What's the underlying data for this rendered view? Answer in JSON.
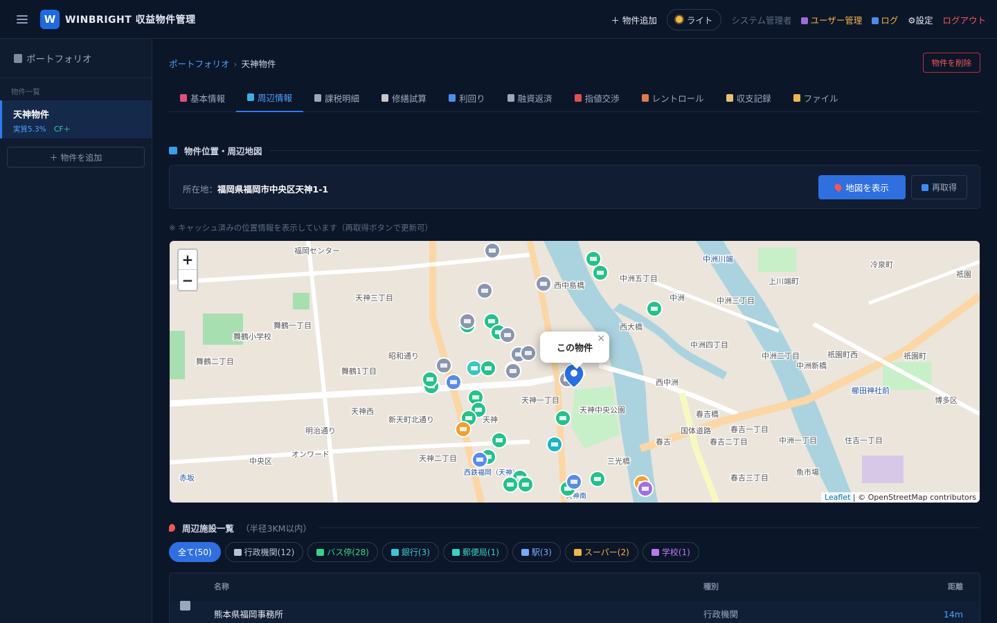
{
  "app": {
    "logo_letter": "W",
    "title": "WINBRIGHT 収益物件管理"
  },
  "topbar": {
    "add_property": "＋ 物件追加",
    "theme": "ライト",
    "role": "システム管理者",
    "user_mgmt": "ユーザー管理",
    "log": "ログ",
    "settings": "⚙設定",
    "logout": "ログアウト"
  },
  "sidebar": {
    "title": "ポートフォリオ",
    "section": "物件一覧",
    "property": {
      "name": "天神物件",
      "yield": "実質5.3%",
      "cf": "CF＋"
    },
    "add_button": "＋ 物件を追加"
  },
  "breadcrumb": {
    "root": "ポートフォリオ",
    "sep": "›",
    "current": "天神物件"
  },
  "delete_button": "物件を削除",
  "tabs": [
    {
      "label": "基本情報",
      "color": "#e0507a"
    },
    {
      "label": "周辺情報",
      "color": "#3ab0e0"
    },
    {
      "label": "課税明細",
      "color": "#9aa8bd"
    },
    {
      "label": "修繕試算",
      "color": "#c8c8c8"
    },
    {
      "label": "利回り",
      "color": "#4a8ee8"
    },
    {
      "label": "融資返済",
      "color": "#9aa8bd"
    },
    {
      "label": "指値交渉",
      "color": "#e05050"
    },
    {
      "label": "レントロール",
      "color": "#e07a50"
    },
    {
      "label": "収支記録",
      "color": "#e8c070"
    },
    {
      "label": "ファイル",
      "color": "#f0b44a"
    }
  ],
  "location": {
    "heading": "物件位置・周辺地図",
    "address_label": "所在地：",
    "address": "福岡県福岡市中央区天神1-1",
    "map_button": "地図を表示",
    "refetch_button": "再取得",
    "cache_note": "※ キャッシュ済みの位置情報を表示しています（再取得ボタンで更新可）"
  },
  "map": {
    "zoom_in": "+",
    "zoom_out": "−",
    "popup": "この物件",
    "popup_close": "×",
    "attribution_leaflet": "Leaflet",
    "attribution_rest": " | © OpenStreetMap contributors",
    "labels": [
      "天神二丁目",
      "天神三丁目",
      "舞鶴一丁目",
      "舞鶴二丁目",
      "舞鶴1丁目",
      "西中島橋",
      "中洲五丁目",
      "中洲",
      "中洲三丁目",
      "上川端町",
      "冷泉町",
      "祇園",
      "中洲川端",
      "西大橋",
      "中洲四丁目",
      "西中洲",
      "中洲二丁目",
      "中洲新橋",
      "祇園町西",
      "祇園町",
      "櫛田神社前",
      "博多区",
      "天神一丁目",
      "天神",
      "天神西",
      "中央区",
      "赤坂",
      "春吉",
      "春吉橋",
      "春吉一丁目",
      "春吉二丁目",
      "春吉三丁目",
      "中洲一丁目",
      "住吉一丁目",
      "西鉄福岡（天神）",
      "天神南",
      "オンワード",
      "新天町北通り",
      "明治通り",
      "昭和通り",
      "国体道路",
      "天神中央公園",
      "舞鶴小学校",
      "福岡センター",
      "三光橋",
      "魚市場"
    ]
  },
  "facilities": {
    "heading": "周辺施設一覧",
    "radius": "（半径3KM以内）",
    "filters": [
      {
        "label": "全て(50)",
        "color": "#ffffff",
        "active": true
      },
      {
        "label": "行政機関(12)",
        "color": "#b8c4d6"
      },
      {
        "label": "バス停(28)",
        "color": "#3ad18a"
      },
      {
        "label": "銀行(3)",
        "color": "#3ac6d6"
      },
      {
        "label": "郵便局(1)",
        "color": "#3ad1c0"
      },
      {
        "label": "駅(3)",
        "color": "#7aa8ff"
      },
      {
        "label": "スーパー(2)",
        "color": "#f0b44a"
      },
      {
        "label": "学校(1)",
        "color": "#b87af0"
      }
    ],
    "columns": {
      "name": "名称",
      "type": "種別",
      "distance": "距離"
    },
    "rows": [
      {
        "name": "熊本県福岡事務所",
        "type": "行政機関",
        "distance": "14m"
      }
    ]
  }
}
